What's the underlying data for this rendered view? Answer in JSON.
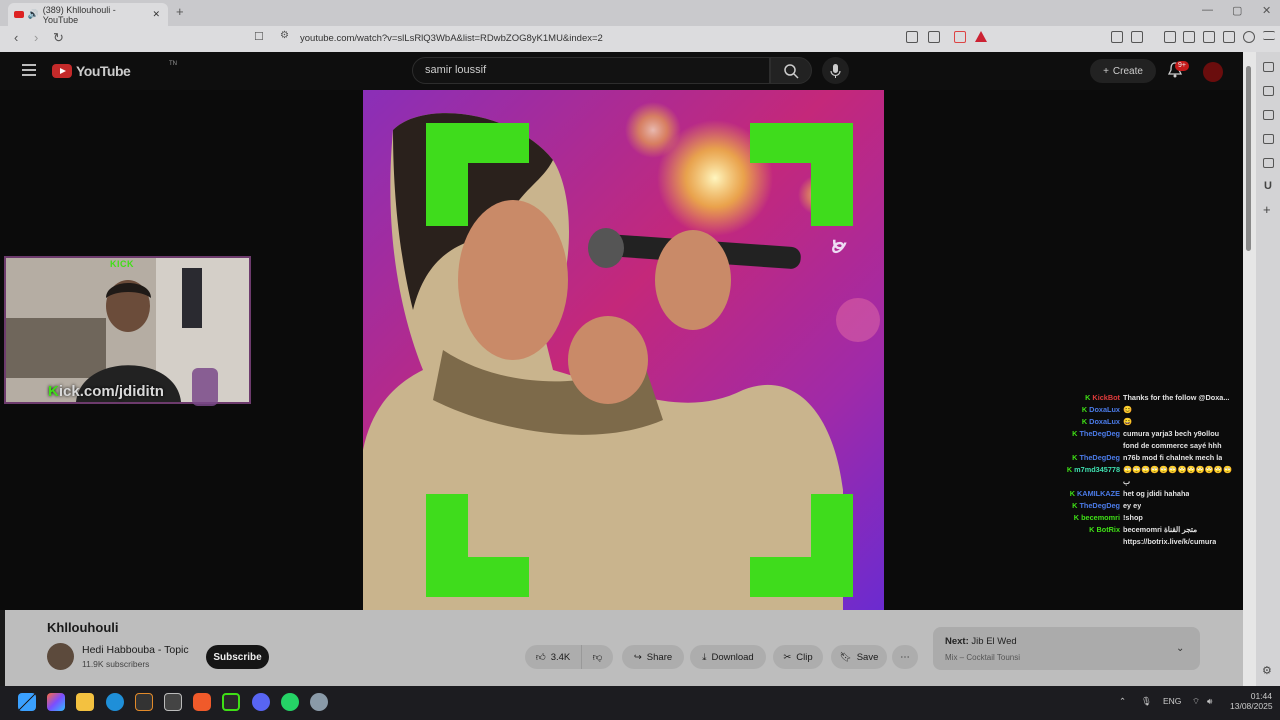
{
  "browser": {
    "tab_title": "(389) Khllouhouli - YouTube",
    "new_tab": "+",
    "url": "youtube.com/watch?v=slLsRlQ3WbA&list=RDwbZOG8yK1MU&index=2",
    "window_controls": [
      "—",
      "▢",
      "✕"
    ]
  },
  "youtube": {
    "logo_text": "YouTube",
    "logo_sup": "TN",
    "search_value": "samir loussif",
    "create_label": "Create",
    "notif_badge": "9+"
  },
  "overlay": {
    "kick_label": "KICK",
    "kick_url_prefix": "K",
    "kick_url_rest": "ick.com/jdiditn"
  },
  "chat": [
    {
      "name": "KickBot",
      "color": "#e23c3c",
      "msg": "Thanks for the follow @Doxa..."
    },
    {
      "name": "DoxaLux",
      "color": "#4b7be8",
      "msg": "😊"
    },
    {
      "name": "DoxaLux",
      "color": "#4b7be8",
      "msg": "😄"
    },
    {
      "name": "TheDegDeg",
      "color": "#4b7be8",
      "msg": "cumura yarja3 bech y9ollou"
    },
    {
      "name": "",
      "color": "#4b7be8",
      "msg": "fond de commerce sayé hhh"
    },
    {
      "name": "TheDegDeg",
      "color": "#4b7be8",
      "msg": "n76b mod fi chalnek mech la"
    },
    {
      "name": "m7md345778",
      "color": "#3fe0b0",
      "msg": "🙄🙄🙄🙄🙄🙄🙄🙄🙄🙄🙄🙄"
    },
    {
      "name": "",
      "color": "#3fe0b0",
      "msg": "ب"
    },
    {
      "name": "KAMILKAZE",
      "color": "#4b7be8",
      "msg": "het og jdidi hahaha"
    },
    {
      "name": "TheDegDeg",
      "color": "#4b7be8",
      "msg": "ey ey"
    },
    {
      "name": "becemomri",
      "color": "#3fe016",
      "msg": "!shop"
    },
    {
      "name": "BotRix",
      "color": "#3fe016",
      "msg": "becemomri متجر القناة"
    },
    {
      "name": "",
      "color": "#3fe016",
      "msg": "https://botrix.live/k/cumura"
    }
  ],
  "video": {
    "title": "Khllouhouli",
    "channel": "Hedi Habbouba - Topic",
    "subscribers": "11.9K subscribers",
    "subscribe_label": "Subscribe",
    "likes": "3.4K",
    "share_label": "Share",
    "download_label": "Download",
    "clip_label": "Clip",
    "save_label": "Save",
    "more_label": "⋯",
    "next_prefix": "Next:",
    "next_title": "Jib El Wed",
    "next_sub": "Mix – Cocktail Tounsi"
  },
  "taskbar": {
    "lang": "ENG",
    "time": "01:44",
    "date": "13/08/2025"
  },
  "colors": {
    "kick_green": "#3fe016",
    "yt_red": "#c42a2a"
  }
}
